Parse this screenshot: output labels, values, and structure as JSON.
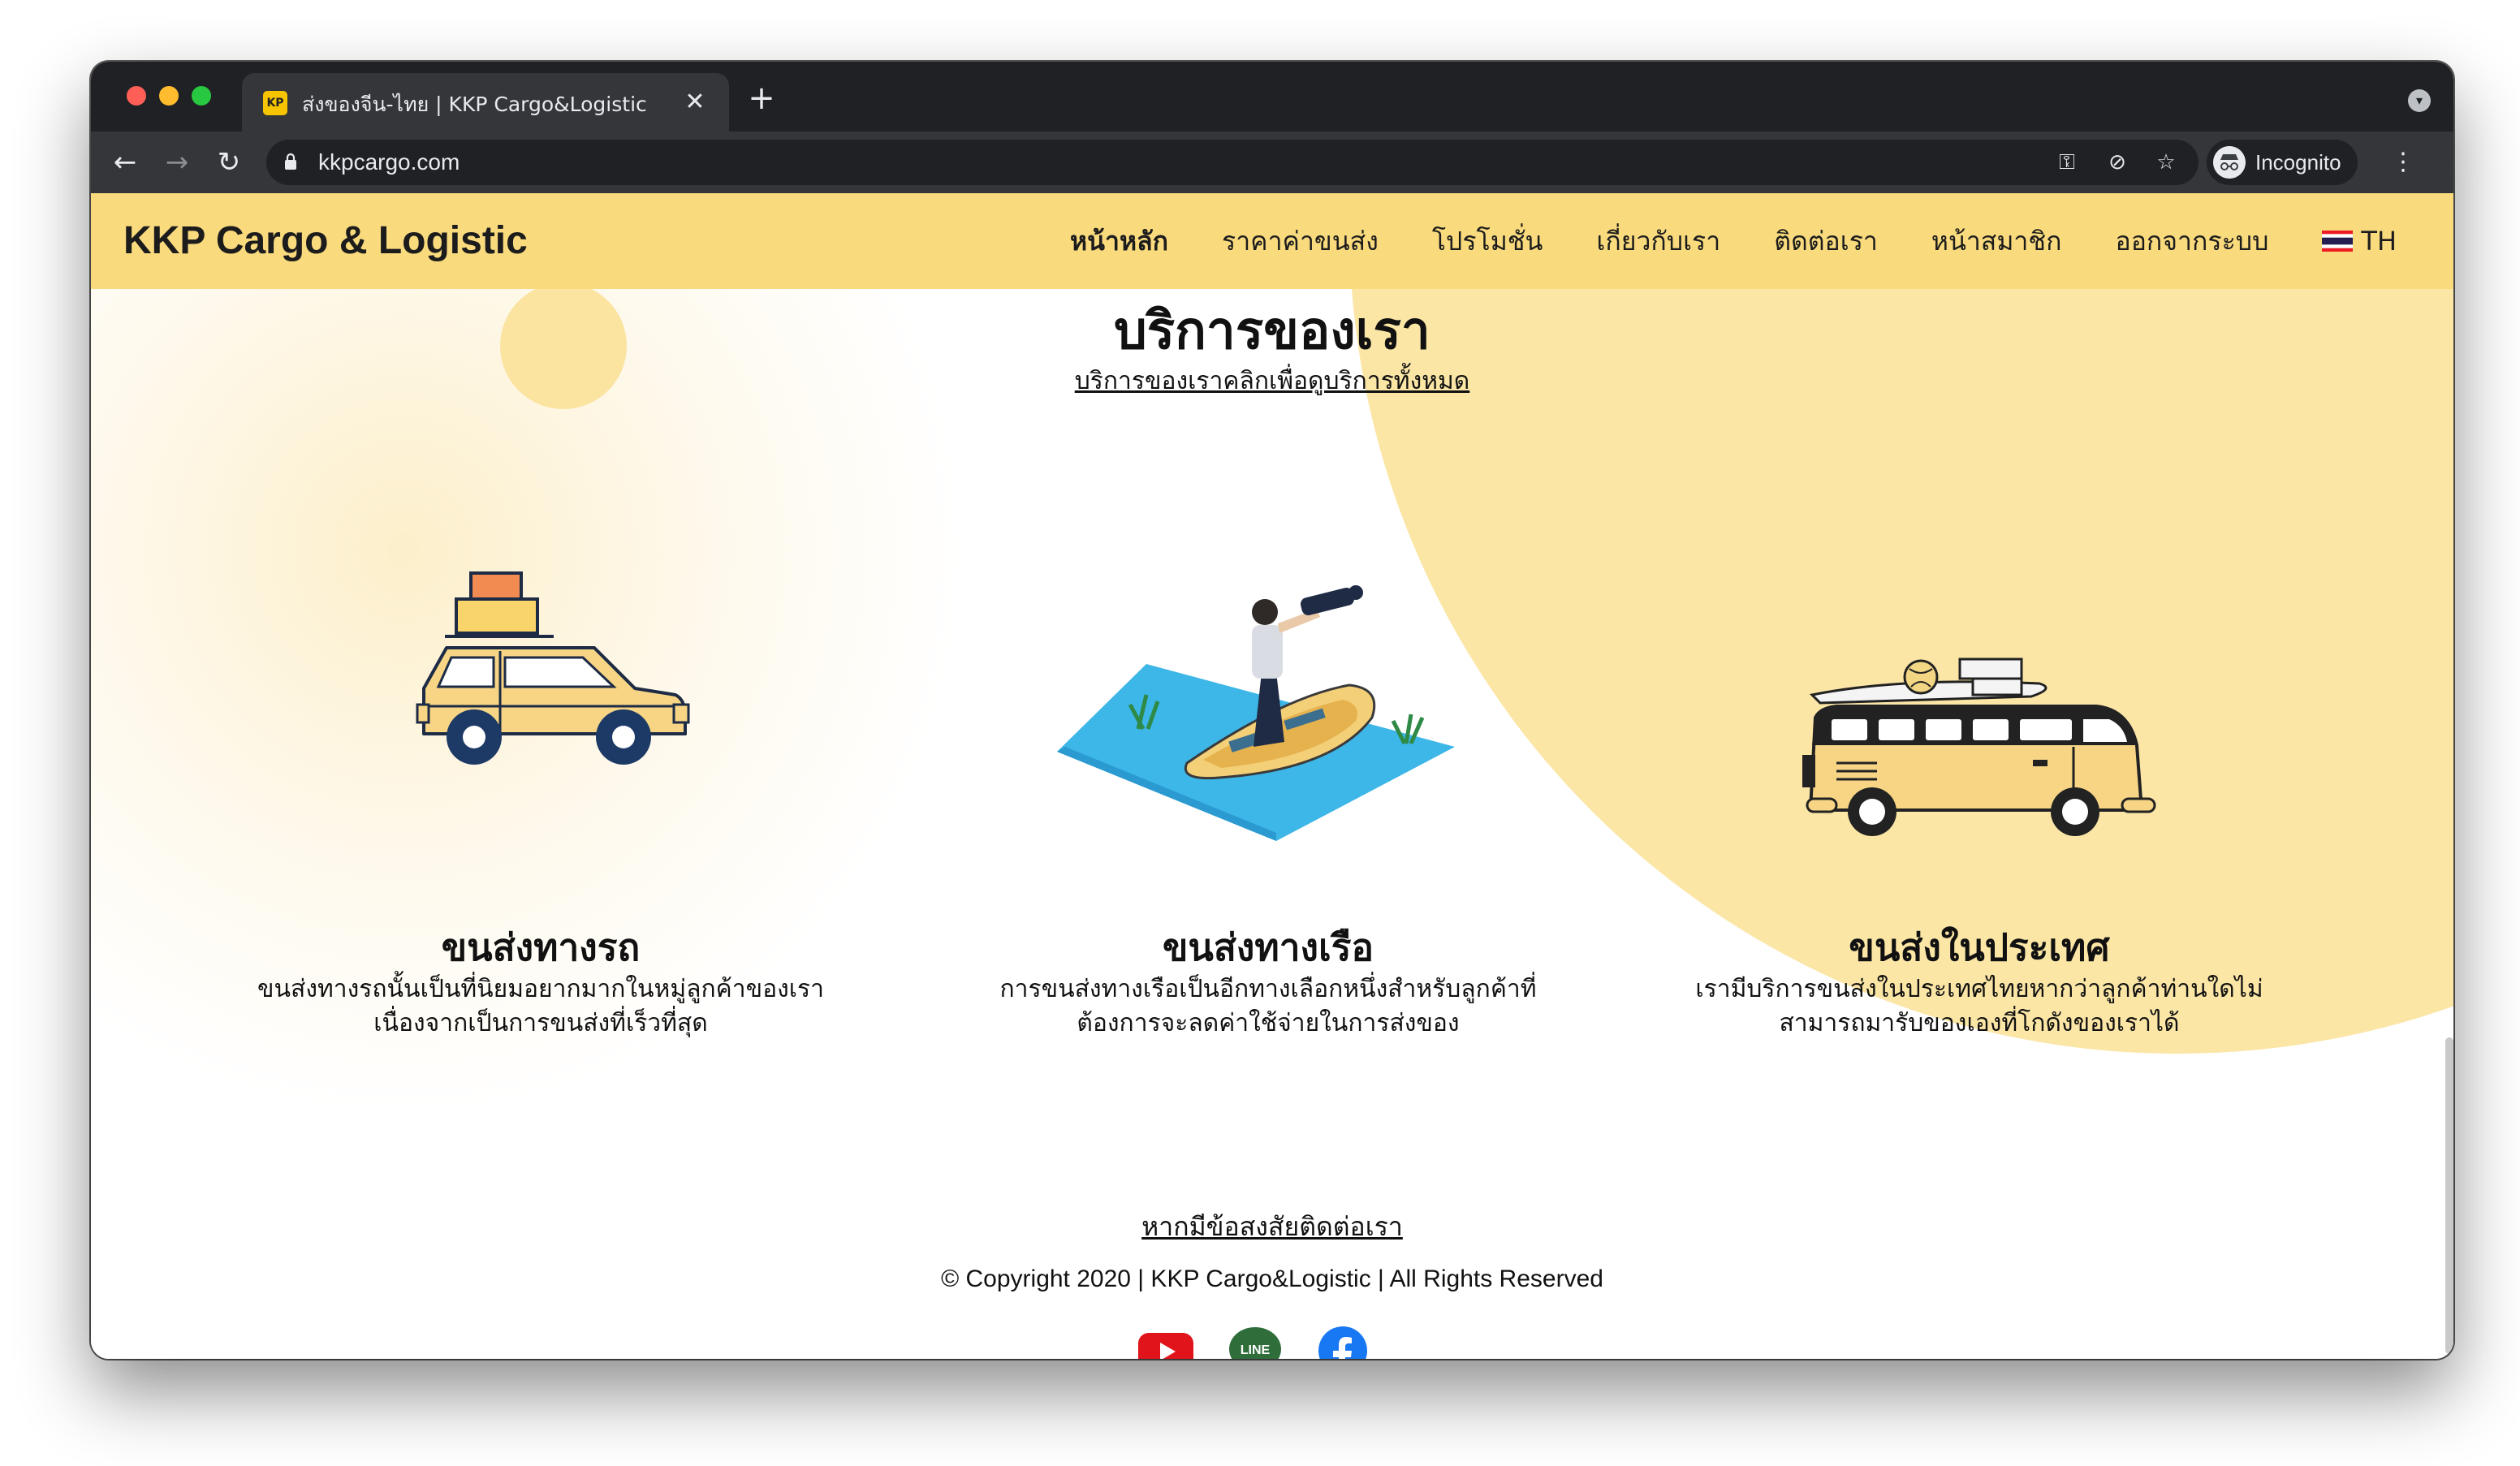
{
  "browser": {
    "tab_title": "ส่งของจีน-ไทย | KKP Cargo&Logistic",
    "tab_favicon": "KP",
    "tab_close": "✕",
    "new_tab": "+",
    "tab_menu": "▾",
    "back": "←",
    "forward": "→",
    "reload": "↻",
    "url": "kkpcargo.com",
    "key_icon": "⚿",
    "eye_off_icon": "⊘",
    "star_icon": "☆",
    "profile_label": "Incognito",
    "menu": "⋮"
  },
  "navbar": {
    "brand": "KKP Cargo & Logistic",
    "links": [
      "หน้าหลัก",
      "ราคาค่าขนส่ง",
      "โปรโมชั่น",
      "เกี่ยวกับเรา",
      "ติดต่อเรา",
      "หน้าสมาชิก",
      "ออกจากระบบ"
    ],
    "lang": "TH"
  },
  "services": {
    "title": "บริการของเรา",
    "subtitle": "บริการของเราคลิกเพื่อดูบริการทั้งหมด",
    "items": [
      {
        "title": "ขนส่งทางรถ",
        "desc1": "ขนส่งทางรถนั้นเป็นที่นิยมอยากมากในหมู่ลูกค้าของเรา",
        "desc2": "เนื่องจากเป็นการขนส่งที่เร็วที่สุด"
      },
      {
        "title": "ขนส่งทางเรือ",
        "desc1": "การขนส่งทางเรือเป็นอีกทางเลือกหนึ่งสำหรับลูกค้าที่",
        "desc2": "ต้องการจะลดค่าใช้จ่ายในการส่งของ"
      },
      {
        "title": "ขนส่งในประเทศ",
        "desc1": "เรามีบริการขนส่งในประเทศไทยหากว่าลูกค้าท่านใดไม่",
        "desc2": "สามารถมารับของเองที่โกดังของเราได้"
      }
    ]
  },
  "footer": {
    "contact": "หากมีข้อสงสัยติดต่อเรา",
    "copyright": "© Copyright 2020 | KKP Cargo&Logistic | All Rights Reserved",
    "line_label": "LINE"
  },
  "icons": [
    "lock-icon",
    "key-icon",
    "eye-off-icon",
    "star-icon",
    "incognito-icon",
    "thai-flag-icon",
    "youtube-icon",
    "line-icon",
    "facebook-icon"
  ],
  "colors": {
    "navbar": "#f9da7d",
    "accent_circle": "#fbe6a6",
    "chrome_dark": "#202124",
    "chrome_toolbar": "#35363a",
    "youtube": "#e1141b",
    "line": "#2f6e3a",
    "facebook": "#1877f2"
  }
}
